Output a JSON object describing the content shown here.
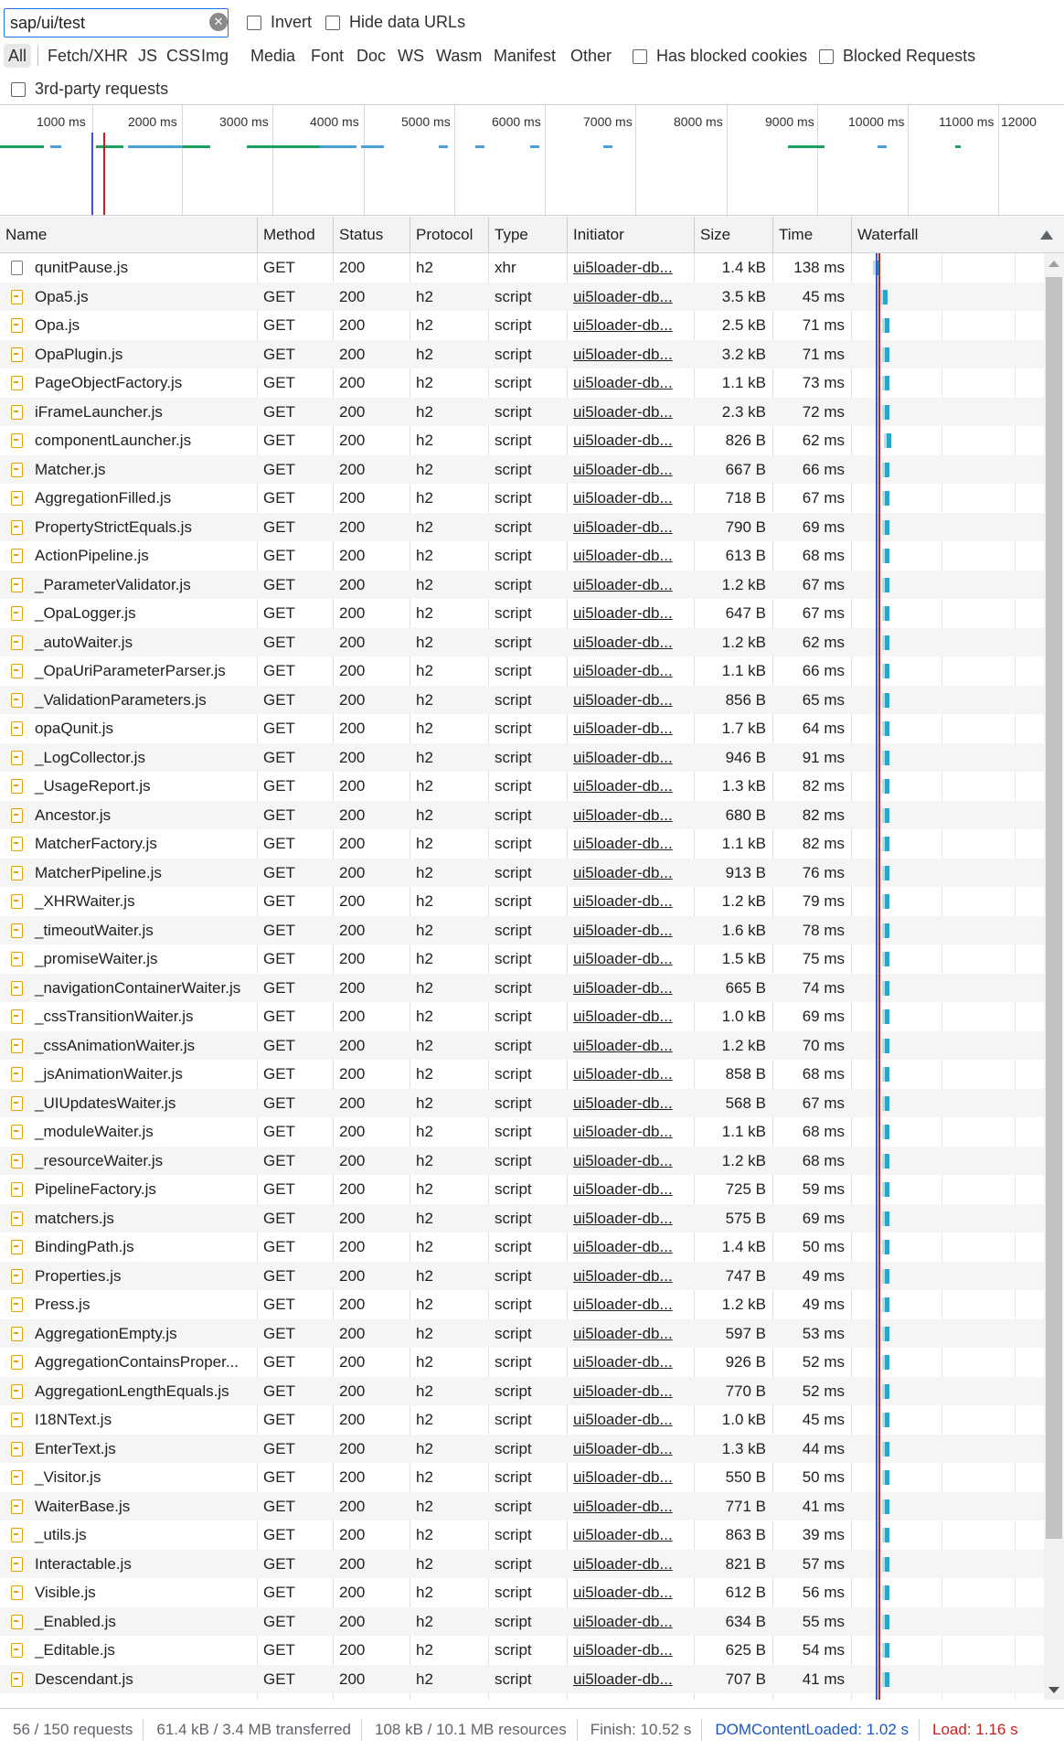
{
  "filter": {
    "value": "sap/ui/test",
    "invert_label": "Invert",
    "hide_data_urls_label": "Hide data URLs",
    "has_blocked_cookies_label": "Has blocked cookies",
    "blocked_requests_label": "Blocked Requests",
    "third_party_label": "3rd-party requests",
    "types": [
      "All",
      "Fetch/XHR",
      "JS",
      "CSS",
      "Img",
      "Media",
      "Font",
      "Doc",
      "WS",
      "Wasm",
      "Manifest",
      "Other"
    ]
  },
  "overview": {
    "ticks": [
      "1000 ms",
      "2000 ms",
      "3000 ms",
      "4000 ms",
      "5000 ms",
      "6000 ms",
      "7000 ms",
      "8000 ms",
      "9000 ms",
      "10000 ms",
      "11000 ms",
      "12000"
    ]
  },
  "columns": [
    "Name",
    "Method",
    "Status",
    "Protocol",
    "Type",
    "Initiator",
    "Size",
    "Time",
    "Waterfall"
  ],
  "rows": [
    {
      "name": "qunitPause.js",
      "method": "GET",
      "status": "200",
      "protocol": "h2",
      "type": "xhr",
      "initiator": "ui5loader-db...",
      "size": "1.4 kB",
      "time": "138 ms"
    },
    {
      "name": "Opa5.js",
      "method": "GET",
      "status": "200",
      "protocol": "h2",
      "type": "script",
      "initiator": "ui5loader-db...",
      "size": "3.5 kB",
      "time": "45 ms"
    },
    {
      "name": "Opa.js",
      "method": "GET",
      "status": "200",
      "protocol": "h2",
      "type": "script",
      "initiator": "ui5loader-db...",
      "size": "2.5 kB",
      "time": "71 ms"
    },
    {
      "name": "OpaPlugin.js",
      "method": "GET",
      "status": "200",
      "protocol": "h2",
      "type": "script",
      "initiator": "ui5loader-db...",
      "size": "3.2 kB",
      "time": "71 ms"
    },
    {
      "name": "PageObjectFactory.js",
      "method": "GET",
      "status": "200",
      "protocol": "h2",
      "type": "script",
      "initiator": "ui5loader-db...",
      "size": "1.1 kB",
      "time": "73 ms"
    },
    {
      "name": "iFrameLauncher.js",
      "method": "GET",
      "status": "200",
      "protocol": "h2",
      "type": "script",
      "initiator": "ui5loader-db...",
      "size": "2.3 kB",
      "time": "72 ms"
    },
    {
      "name": "componentLauncher.js",
      "method": "GET",
      "status": "200",
      "protocol": "h2",
      "type": "script",
      "initiator": "ui5loader-db...",
      "size": "826 B",
      "time": "62 ms"
    },
    {
      "name": "Matcher.js",
      "method": "GET",
      "status": "200",
      "protocol": "h2",
      "type": "script",
      "initiator": "ui5loader-db...",
      "size": "667 B",
      "time": "66 ms"
    },
    {
      "name": "AggregationFilled.js",
      "method": "GET",
      "status": "200",
      "protocol": "h2",
      "type": "script",
      "initiator": "ui5loader-db...",
      "size": "718 B",
      "time": "67 ms"
    },
    {
      "name": "PropertyStrictEquals.js",
      "method": "GET",
      "status": "200",
      "protocol": "h2",
      "type": "script",
      "initiator": "ui5loader-db...",
      "size": "790 B",
      "time": "69 ms"
    },
    {
      "name": "ActionPipeline.js",
      "method": "GET",
      "status": "200",
      "protocol": "h2",
      "type": "script",
      "initiator": "ui5loader-db...",
      "size": "613 B",
      "time": "68 ms"
    },
    {
      "name": "_ParameterValidator.js",
      "method": "GET",
      "status": "200",
      "protocol": "h2",
      "type": "script",
      "initiator": "ui5loader-db...",
      "size": "1.2 kB",
      "time": "67 ms"
    },
    {
      "name": "_OpaLogger.js",
      "method": "GET",
      "status": "200",
      "protocol": "h2",
      "type": "script",
      "initiator": "ui5loader-db...",
      "size": "647 B",
      "time": "67 ms"
    },
    {
      "name": "_autoWaiter.js",
      "method": "GET",
      "status": "200",
      "protocol": "h2",
      "type": "script",
      "initiator": "ui5loader-db...",
      "size": "1.2 kB",
      "time": "62 ms"
    },
    {
      "name": "_OpaUriParameterParser.js",
      "method": "GET",
      "status": "200",
      "protocol": "h2",
      "type": "script",
      "initiator": "ui5loader-db...",
      "size": "1.1 kB",
      "time": "66 ms"
    },
    {
      "name": "_ValidationParameters.js",
      "method": "GET",
      "status": "200",
      "protocol": "h2",
      "type": "script",
      "initiator": "ui5loader-db...",
      "size": "856 B",
      "time": "65 ms"
    },
    {
      "name": "opaQunit.js",
      "method": "GET",
      "status": "200",
      "protocol": "h2",
      "type": "script",
      "initiator": "ui5loader-db...",
      "size": "1.7 kB",
      "time": "64 ms"
    },
    {
      "name": "_LogCollector.js",
      "method": "GET",
      "status": "200",
      "protocol": "h2",
      "type": "script",
      "initiator": "ui5loader-db...",
      "size": "946 B",
      "time": "91 ms"
    },
    {
      "name": "_UsageReport.js",
      "method": "GET",
      "status": "200",
      "protocol": "h2",
      "type": "script",
      "initiator": "ui5loader-db...",
      "size": "1.3 kB",
      "time": "82 ms"
    },
    {
      "name": "Ancestor.js",
      "method": "GET",
      "status": "200",
      "protocol": "h2",
      "type": "script",
      "initiator": "ui5loader-db...",
      "size": "680 B",
      "time": "82 ms"
    },
    {
      "name": "MatcherFactory.js",
      "method": "GET",
      "status": "200",
      "protocol": "h2",
      "type": "script",
      "initiator": "ui5loader-db...",
      "size": "1.1 kB",
      "time": "82 ms"
    },
    {
      "name": "MatcherPipeline.js",
      "method": "GET",
      "status": "200",
      "protocol": "h2",
      "type": "script",
      "initiator": "ui5loader-db...",
      "size": "913 B",
      "time": "76 ms"
    },
    {
      "name": "_XHRWaiter.js",
      "method": "GET",
      "status": "200",
      "protocol": "h2",
      "type": "script",
      "initiator": "ui5loader-db...",
      "size": "1.2 kB",
      "time": "79 ms"
    },
    {
      "name": "_timeoutWaiter.js",
      "method": "GET",
      "status": "200",
      "protocol": "h2",
      "type": "script",
      "initiator": "ui5loader-db...",
      "size": "1.6 kB",
      "time": "78 ms"
    },
    {
      "name": "_promiseWaiter.js",
      "method": "GET",
      "status": "200",
      "protocol": "h2",
      "type": "script",
      "initiator": "ui5loader-db...",
      "size": "1.5 kB",
      "time": "75 ms"
    },
    {
      "name": "_navigationContainerWaiter.js",
      "method": "GET",
      "status": "200",
      "protocol": "h2",
      "type": "script",
      "initiator": "ui5loader-db...",
      "size": "665 B",
      "time": "74 ms"
    },
    {
      "name": "_cssTransitionWaiter.js",
      "method": "GET",
      "status": "200",
      "protocol": "h2",
      "type": "script",
      "initiator": "ui5loader-db...",
      "size": "1.0 kB",
      "time": "69 ms"
    },
    {
      "name": "_cssAnimationWaiter.js",
      "method": "GET",
      "status": "200",
      "protocol": "h2",
      "type": "script",
      "initiator": "ui5loader-db...",
      "size": "1.2 kB",
      "time": "70 ms"
    },
    {
      "name": "_jsAnimationWaiter.js",
      "method": "GET",
      "status": "200",
      "protocol": "h2",
      "type": "script",
      "initiator": "ui5loader-db...",
      "size": "858 B",
      "time": "68 ms"
    },
    {
      "name": "_UIUpdatesWaiter.js",
      "method": "GET",
      "status": "200",
      "protocol": "h2",
      "type": "script",
      "initiator": "ui5loader-db...",
      "size": "568 B",
      "time": "67 ms"
    },
    {
      "name": "_moduleWaiter.js",
      "method": "GET",
      "status": "200",
      "protocol": "h2",
      "type": "script",
      "initiator": "ui5loader-db...",
      "size": "1.1 kB",
      "time": "68 ms"
    },
    {
      "name": "_resourceWaiter.js",
      "method": "GET",
      "status": "200",
      "protocol": "h2",
      "type": "script",
      "initiator": "ui5loader-db...",
      "size": "1.2 kB",
      "time": "68 ms"
    },
    {
      "name": "PipelineFactory.js",
      "method": "GET",
      "status": "200",
      "protocol": "h2",
      "type": "script",
      "initiator": "ui5loader-db...",
      "size": "725 B",
      "time": "59 ms"
    },
    {
      "name": "matchers.js",
      "method": "GET",
      "status": "200",
      "protocol": "h2",
      "type": "script",
      "initiator": "ui5loader-db...",
      "size": "575 B",
      "time": "69 ms"
    },
    {
      "name": "BindingPath.js",
      "method": "GET",
      "status": "200",
      "protocol": "h2",
      "type": "script",
      "initiator": "ui5loader-db...",
      "size": "1.4 kB",
      "time": "50 ms"
    },
    {
      "name": "Properties.js",
      "method": "GET",
      "status": "200",
      "protocol": "h2",
      "type": "script",
      "initiator": "ui5loader-db...",
      "size": "747 B",
      "time": "49 ms"
    },
    {
      "name": "Press.js",
      "method": "GET",
      "status": "200",
      "protocol": "h2",
      "type": "script",
      "initiator": "ui5loader-db...",
      "size": "1.2 kB",
      "time": "49 ms"
    },
    {
      "name": "AggregationEmpty.js",
      "method": "GET",
      "status": "200",
      "protocol": "h2",
      "type": "script",
      "initiator": "ui5loader-db...",
      "size": "597 B",
      "time": "53 ms"
    },
    {
      "name": "AggregationContainsProper...",
      "method": "GET",
      "status": "200",
      "protocol": "h2",
      "type": "script",
      "initiator": "ui5loader-db...",
      "size": "926 B",
      "time": "52 ms"
    },
    {
      "name": "AggregationLengthEquals.js",
      "method": "GET",
      "status": "200",
      "protocol": "h2",
      "type": "script",
      "initiator": "ui5loader-db...",
      "size": "770 B",
      "time": "52 ms"
    },
    {
      "name": "I18NText.js",
      "method": "GET",
      "status": "200",
      "protocol": "h2",
      "type": "script",
      "initiator": "ui5loader-db...",
      "size": "1.0 kB",
      "time": "45 ms"
    },
    {
      "name": "EnterText.js",
      "method": "GET",
      "status": "200",
      "protocol": "h2",
      "type": "script",
      "initiator": "ui5loader-db...",
      "size": "1.3 kB",
      "time": "44 ms"
    },
    {
      "name": "_Visitor.js",
      "method": "GET",
      "status": "200",
      "protocol": "h2",
      "type": "script",
      "initiator": "ui5loader-db...",
      "size": "550 B",
      "time": "50 ms"
    },
    {
      "name": "WaiterBase.js",
      "method": "GET",
      "status": "200",
      "protocol": "h2",
      "type": "script",
      "initiator": "ui5loader-db...",
      "size": "771 B",
      "time": "41 ms"
    },
    {
      "name": "_utils.js",
      "method": "GET",
      "status": "200",
      "protocol": "h2",
      "type": "script",
      "initiator": "ui5loader-db...",
      "size": "863 B",
      "time": "39 ms"
    },
    {
      "name": "Interactable.js",
      "method": "GET",
      "status": "200",
      "protocol": "h2",
      "type": "script",
      "initiator": "ui5loader-db...",
      "size": "821 B",
      "time": "57 ms"
    },
    {
      "name": "Visible.js",
      "method": "GET",
      "status": "200",
      "protocol": "h2",
      "type": "script",
      "initiator": "ui5loader-db...",
      "size": "612 B",
      "time": "56 ms"
    },
    {
      "name": "_Enabled.js",
      "method": "GET",
      "status": "200",
      "protocol": "h2",
      "type": "script",
      "initiator": "ui5loader-db...",
      "size": "634 B",
      "time": "55 ms"
    },
    {
      "name": "_Editable.js",
      "method": "GET",
      "status": "200",
      "protocol": "h2",
      "type": "script",
      "initiator": "ui5loader-db...",
      "size": "625 B",
      "time": "54 ms"
    },
    {
      "name": "Descendant.js",
      "method": "GET",
      "status": "200",
      "protocol": "h2",
      "type": "script",
      "initiator": "ui5loader-db...",
      "size": "707 B",
      "time": "41 ms"
    }
  ],
  "status_bar": {
    "requests": "56 / 150 requests",
    "transferred": "61.4 kB / 3.4 MB transferred",
    "resources": "108 kB / 10.1 MB resources",
    "finish": "Finish: 10.52 s",
    "dom_content_loaded": "DOMContentLoaded: 1.02 s",
    "load": "Load: 1.16 s"
  },
  "colors": {
    "accent": "#1a73e8",
    "dom_content_loaded": "#3b56c8",
    "load": "#c5221f",
    "waterfall_bar": "#2aa6c4"
  }
}
